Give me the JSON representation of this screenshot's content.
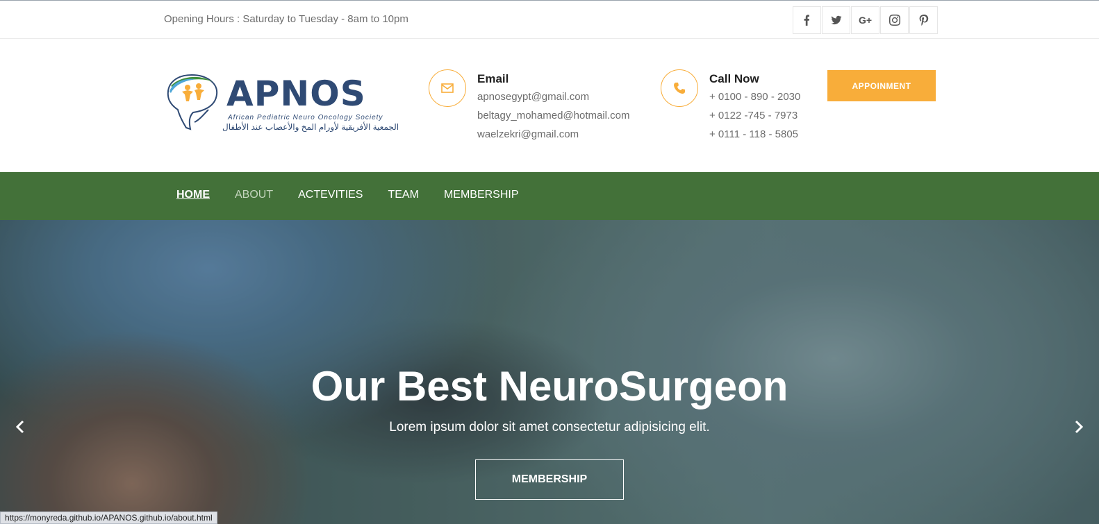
{
  "topbar": {
    "opening_hours": "Opening Hours : Saturday to Tuesday - 8am to 10pm",
    "social": [
      "facebook-icon",
      "twitter-icon",
      "google-plus-icon",
      "instagram-icon",
      "pinterest-icon"
    ],
    "google_plus_glyph": "G+"
  },
  "logo": {
    "name": "APNOS",
    "subtitle": "African Pediatric Neuro Oncology Society",
    "arabic": "الجمعية الأفريقية لأورام المخ والأعصاب عند الأطفال"
  },
  "contact": {
    "email_title": "Email",
    "emails": [
      "apnosegypt@gmail.com",
      "beltagy_mohamed@hotmail.com",
      "waelzekri@gmail.com"
    ],
    "call_title": "Call Now",
    "phones": [
      "+ 0100 - 890 - 2030",
      "+ 0122 -745 - 7973",
      "+ 0111 - 118 - 5805"
    ]
  },
  "appointment_button": "APPOINMENT",
  "nav": {
    "items": [
      "HOME",
      "ABOUT",
      "ACTEVITIES",
      "TEAM",
      "MEMBERSHIP"
    ],
    "active": "HOME"
  },
  "hero": {
    "title": "Our Best NeuroSurgeon",
    "subtitle": "Lorem ipsum dolor sit amet consectetur adipisicing elit.",
    "button": "MEMBERSHIP"
  },
  "status_url": "https://monyreda.github.io/APANOS.github.io/about.html",
  "colors": {
    "accent": "#f8ad3a",
    "nav_bg": "#437139",
    "brand_blue": "#2f4a74"
  }
}
